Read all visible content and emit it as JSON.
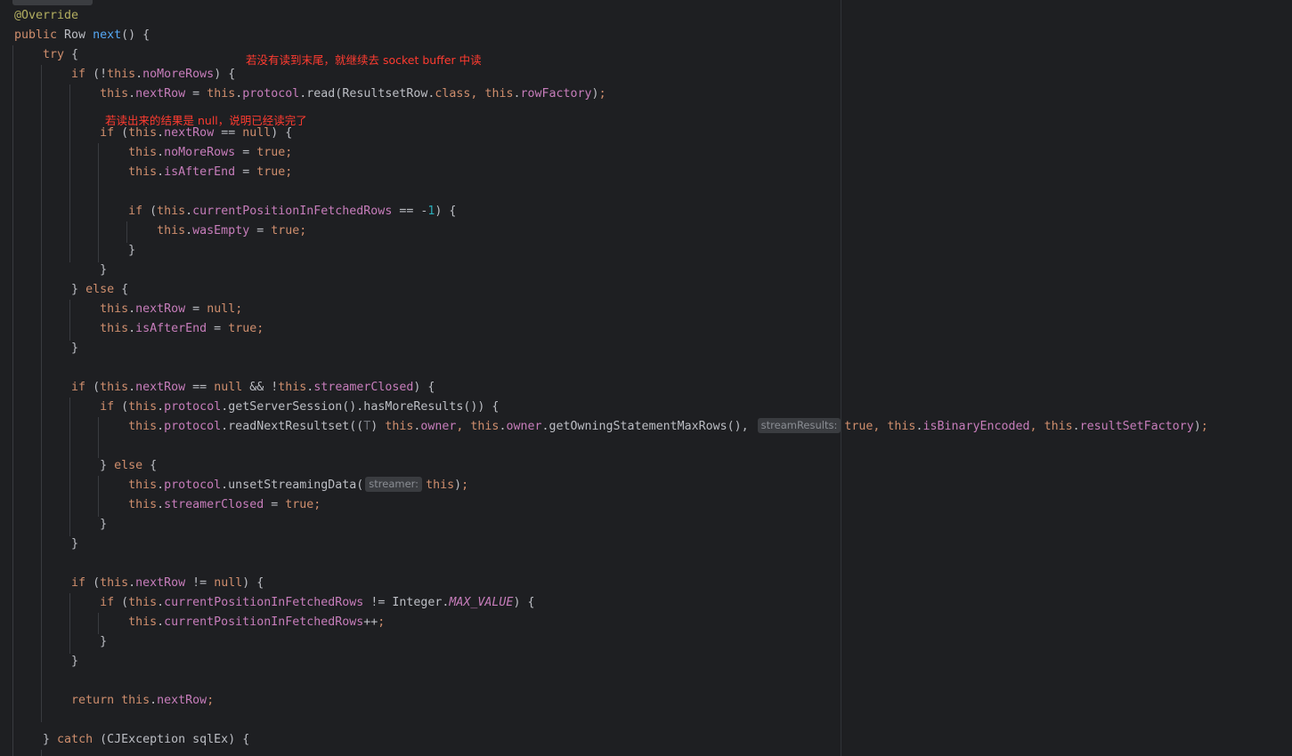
{
  "annotations": [
    "若没有读到末尾，就继续去 socket buffer 中读",
    "若读出来的结果是 null，说明已经读完了"
  ],
  "param_hints": {
    "stream_results": "streamResults:",
    "streamer": "streamer:"
  },
  "code_lines": [
    [
      {
        "t": "@Override",
        "c": "ann"
      }
    ],
    [
      {
        "t": "public ",
        "c": "kw"
      },
      {
        "t": "Row ",
        "c": "typ"
      },
      {
        "t": "next",
        "c": "fn"
      },
      {
        "t": "() {",
        "c": "op"
      }
    ],
    [
      {
        "t": "    try ",
        "c": "kw"
      },
      {
        "t": "{",
        "c": "op"
      }
    ],
    [
      {
        "t": "        if ",
        "c": "kw"
      },
      {
        "t": "(!",
        "c": "op"
      },
      {
        "t": "this",
        "c": "kw"
      },
      {
        "t": ".",
        "c": "op"
      },
      {
        "t": "noMoreRows",
        "c": "fld"
      },
      {
        "t": ") {",
        "c": "op"
      }
    ],
    [
      {
        "t": "            this",
        "c": "kw"
      },
      {
        "t": ".",
        "c": "op"
      },
      {
        "t": "nextRow",
        "c": "fld"
      },
      {
        "t": " = ",
        "c": "op"
      },
      {
        "t": "this",
        "c": "kw"
      },
      {
        "t": ".",
        "c": "op"
      },
      {
        "t": "protocol",
        "c": "fld"
      },
      {
        "t": ".read(ResultsetRow.",
        "c": "op"
      },
      {
        "t": "class",
        "c": "kw"
      },
      {
        "t": ", ",
        "c": "semi"
      },
      {
        "t": "this",
        "c": "kw"
      },
      {
        "t": ".",
        "c": "op"
      },
      {
        "t": "rowFactory",
        "c": "fld"
      },
      {
        "t": ")",
        "c": "op"
      },
      {
        "t": ";",
        "c": "semi"
      }
    ],
    [],
    [
      {
        "t": "            if ",
        "c": "kw"
      },
      {
        "t": "(",
        "c": "op"
      },
      {
        "t": "this",
        "c": "kw"
      },
      {
        "t": ".",
        "c": "op"
      },
      {
        "t": "nextRow",
        "c": "fld"
      },
      {
        "t": " == ",
        "c": "op"
      },
      {
        "t": "null",
        "c": "kw"
      },
      {
        "t": ") {",
        "c": "op"
      }
    ],
    [
      {
        "t": "                this",
        "c": "kw"
      },
      {
        "t": ".",
        "c": "op"
      },
      {
        "t": "noMoreRows",
        "c": "fld"
      },
      {
        "t": " = ",
        "c": "op"
      },
      {
        "t": "true",
        "c": "kw"
      },
      {
        "t": ";",
        "c": "semi"
      }
    ],
    [
      {
        "t": "                this",
        "c": "kw"
      },
      {
        "t": ".",
        "c": "op"
      },
      {
        "t": "isAfterEnd",
        "c": "fld"
      },
      {
        "t": " = ",
        "c": "op"
      },
      {
        "t": "true",
        "c": "kw"
      },
      {
        "t": ";",
        "c": "semi"
      }
    ],
    [],
    [
      {
        "t": "                if ",
        "c": "kw"
      },
      {
        "t": "(",
        "c": "op"
      },
      {
        "t": "this",
        "c": "kw"
      },
      {
        "t": ".",
        "c": "op"
      },
      {
        "t": "currentPositionInFetchedRows",
        "c": "fld"
      },
      {
        "t": " == -",
        "c": "op"
      },
      {
        "t": "1",
        "c": "num"
      },
      {
        "t": ") {",
        "c": "op"
      }
    ],
    [
      {
        "t": "                    this",
        "c": "kw"
      },
      {
        "t": ".",
        "c": "op"
      },
      {
        "t": "wasEmpty",
        "c": "fld"
      },
      {
        "t": " = ",
        "c": "op"
      },
      {
        "t": "true",
        "c": "kw"
      },
      {
        "t": ";",
        "c": "semi"
      }
    ],
    [
      {
        "t": "                }",
        "c": "op"
      }
    ],
    [
      {
        "t": "            }",
        "c": "op"
      }
    ],
    [
      {
        "t": "        } ",
        "c": "op"
      },
      {
        "t": "else ",
        "c": "kw"
      },
      {
        "t": "{",
        "c": "op"
      }
    ],
    [
      {
        "t": "            this",
        "c": "kw"
      },
      {
        "t": ".",
        "c": "op"
      },
      {
        "t": "nextRow",
        "c": "fld"
      },
      {
        "t": " = ",
        "c": "op"
      },
      {
        "t": "null",
        "c": "kw"
      },
      {
        "t": ";",
        "c": "semi"
      }
    ],
    [
      {
        "t": "            this",
        "c": "kw"
      },
      {
        "t": ".",
        "c": "op"
      },
      {
        "t": "isAfterEnd",
        "c": "fld"
      },
      {
        "t": " = ",
        "c": "op"
      },
      {
        "t": "true",
        "c": "kw"
      },
      {
        "t": ";",
        "c": "semi"
      }
    ],
    [
      {
        "t": "        }",
        "c": "op"
      }
    ],
    [],
    [
      {
        "t": "        if ",
        "c": "kw"
      },
      {
        "t": "(",
        "c": "op"
      },
      {
        "t": "this",
        "c": "kw"
      },
      {
        "t": ".",
        "c": "op"
      },
      {
        "t": "nextRow",
        "c": "fld"
      },
      {
        "t": " == ",
        "c": "op"
      },
      {
        "t": "null",
        "c": "kw"
      },
      {
        "t": " && !",
        "c": "op"
      },
      {
        "t": "this",
        "c": "kw"
      },
      {
        "t": ".",
        "c": "op"
      },
      {
        "t": "streamerClosed",
        "c": "fld"
      },
      {
        "t": ") {",
        "c": "op"
      }
    ],
    [
      {
        "t": "            if ",
        "c": "kw"
      },
      {
        "t": "(",
        "c": "op"
      },
      {
        "t": "this",
        "c": "kw"
      },
      {
        "t": ".",
        "c": "op"
      },
      {
        "t": "protocol",
        "c": "fld"
      },
      {
        "t": ".getServerSession().hasMoreResults()) {",
        "c": "op"
      }
    ],
    [
      {
        "t": "                this",
        "c": "kw"
      },
      {
        "t": ".",
        "c": "op"
      },
      {
        "t": "protocol",
        "c": "fld"
      },
      {
        "t": ".readNextResultset((",
        "c": "op"
      },
      {
        "t": "T",
        "c": "gen"
      },
      {
        "t": ") ",
        "c": "op"
      },
      {
        "t": "this",
        "c": "kw"
      },
      {
        "t": ".",
        "c": "op"
      },
      {
        "t": "owner",
        "c": "fld"
      },
      {
        "t": ", ",
        "c": "semi"
      },
      {
        "t": "this",
        "c": "kw"
      },
      {
        "t": ".",
        "c": "op"
      },
      {
        "t": "owner",
        "c": "fld"
      },
      {
        "t": ".getOwningStatementMaxRows(), ",
        "c": "op"
      },
      {
        "t": "streamResults:",
        "c": "hint"
      },
      {
        "t": "true",
        "c": "kw"
      },
      {
        "t": ", ",
        "c": "semi"
      },
      {
        "t": "this",
        "c": "kw"
      },
      {
        "t": ".",
        "c": "op"
      },
      {
        "t": "isBinaryEncoded",
        "c": "fld"
      },
      {
        "t": ", ",
        "c": "semi"
      },
      {
        "t": "this",
        "c": "kw"
      },
      {
        "t": ".",
        "c": "op"
      },
      {
        "t": "resultSetFactory",
        "c": "fld"
      },
      {
        "t": ")",
        "c": "op"
      },
      {
        "t": ";",
        "c": "semi"
      }
    ],
    [],
    [
      {
        "t": "            } ",
        "c": "op"
      },
      {
        "t": "else ",
        "c": "kw"
      },
      {
        "t": "{",
        "c": "op"
      }
    ],
    [
      {
        "t": "                this",
        "c": "kw"
      },
      {
        "t": ".",
        "c": "op"
      },
      {
        "t": "protocol",
        "c": "fld"
      },
      {
        "t": ".unsetStreamingData(",
        "c": "op"
      },
      {
        "t": "streamer:",
        "c": "hint"
      },
      {
        "t": "this",
        "c": "kw"
      },
      {
        "t": ")",
        "c": "op"
      },
      {
        "t": ";",
        "c": "semi"
      }
    ],
    [
      {
        "t": "                this",
        "c": "kw"
      },
      {
        "t": ".",
        "c": "op"
      },
      {
        "t": "streamerClosed",
        "c": "fld"
      },
      {
        "t": " = ",
        "c": "op"
      },
      {
        "t": "true",
        "c": "kw"
      },
      {
        "t": ";",
        "c": "semi"
      }
    ],
    [
      {
        "t": "            }",
        "c": "op"
      }
    ],
    [
      {
        "t": "        }",
        "c": "op"
      }
    ],
    [],
    [
      {
        "t": "        if ",
        "c": "kw"
      },
      {
        "t": "(",
        "c": "op"
      },
      {
        "t": "this",
        "c": "kw"
      },
      {
        "t": ".",
        "c": "op"
      },
      {
        "t": "nextRow",
        "c": "fld"
      },
      {
        "t": " != ",
        "c": "op"
      },
      {
        "t": "null",
        "c": "kw"
      },
      {
        "t": ") {",
        "c": "op"
      }
    ],
    [
      {
        "t": "            if ",
        "c": "kw"
      },
      {
        "t": "(",
        "c": "op"
      },
      {
        "t": "this",
        "c": "kw"
      },
      {
        "t": ".",
        "c": "op"
      },
      {
        "t": "currentPositionInFetchedRows",
        "c": "fld"
      },
      {
        "t": " != Integer.",
        "c": "op"
      },
      {
        "t": "MAX_VALUE",
        "c": "cst"
      },
      {
        "t": ") {",
        "c": "op"
      }
    ],
    [
      {
        "t": "                this",
        "c": "kw"
      },
      {
        "t": ".",
        "c": "op"
      },
      {
        "t": "currentPositionInFetchedRows",
        "c": "fld"
      },
      {
        "t": "++",
        "c": "op"
      },
      {
        "t": ";",
        "c": "semi"
      }
    ],
    [
      {
        "t": "            }",
        "c": "op"
      }
    ],
    [
      {
        "t": "        }",
        "c": "op"
      }
    ],
    [],
    [
      {
        "t": "        return ",
        "c": "kw"
      },
      {
        "t": "this",
        "c": "kw"
      },
      {
        "t": ".",
        "c": "op"
      },
      {
        "t": "nextRow",
        "c": "fld"
      },
      {
        "t": ";",
        "c": "semi"
      }
    ],
    [],
    [
      {
        "t": "    } ",
        "c": "op"
      },
      {
        "t": "catch ",
        "c": "kw"
      },
      {
        "t": "(CJException sqlEx) {",
        "c": "op"
      }
    ]
  ]
}
